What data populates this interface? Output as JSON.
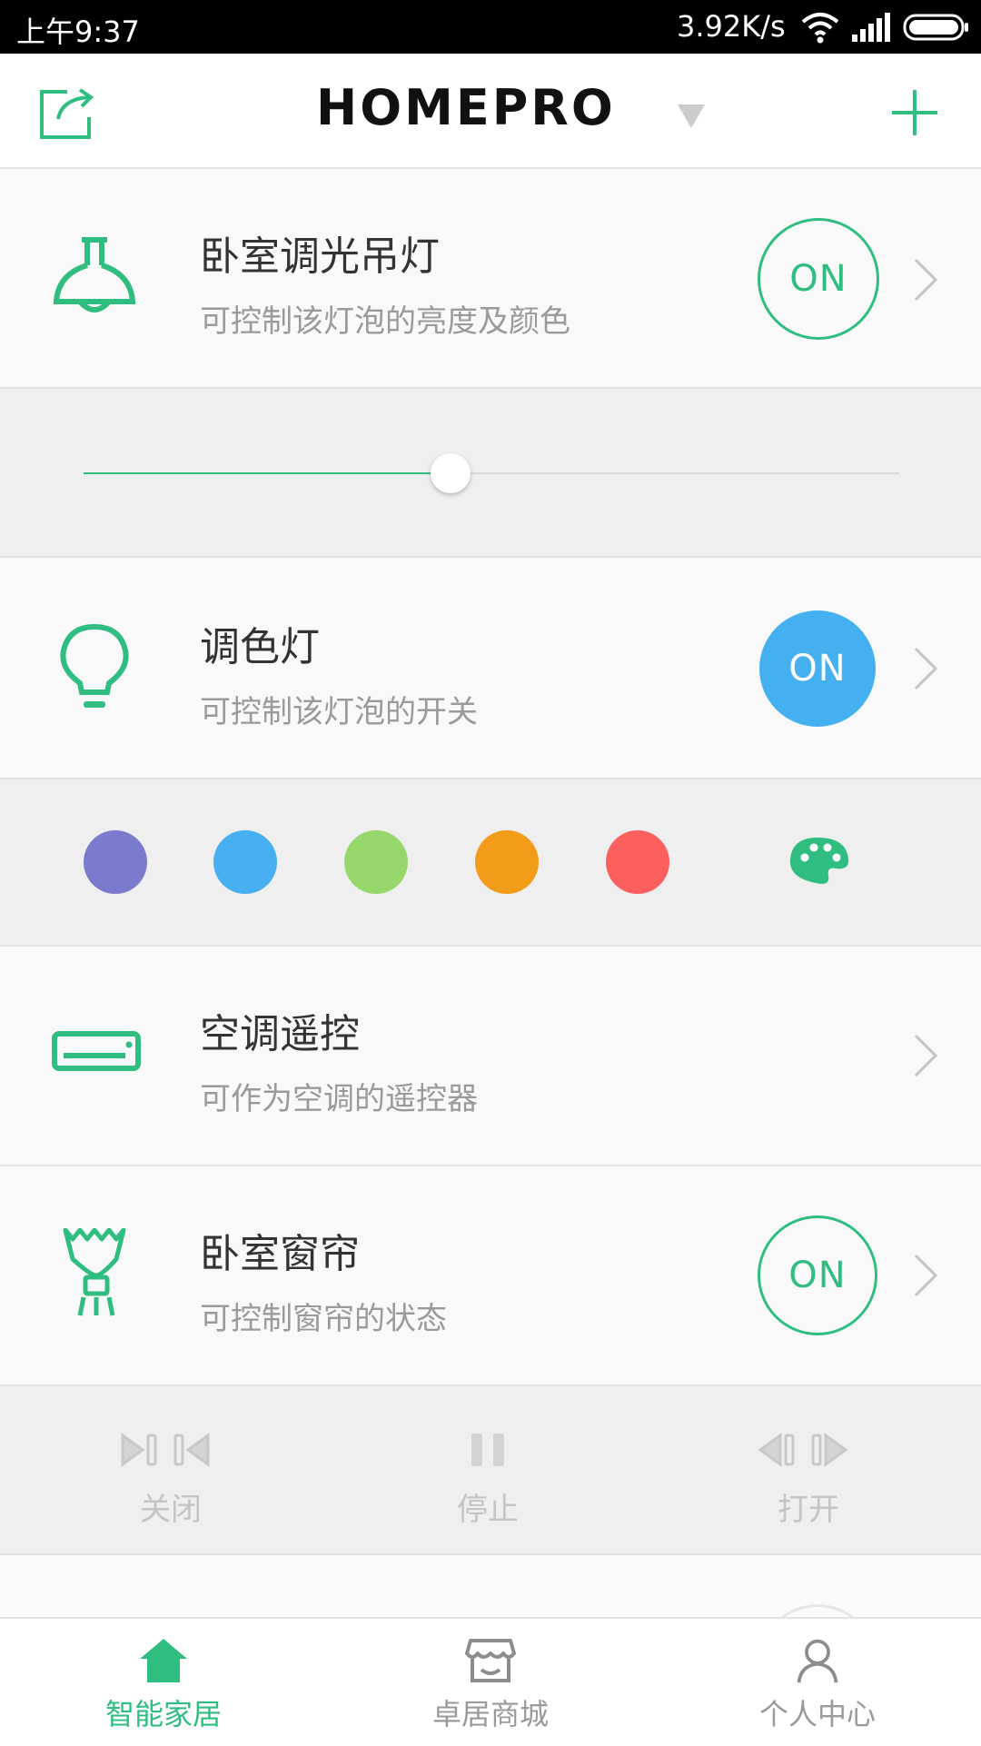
{
  "status_bar": {
    "time": "上午9:37",
    "net_speed": "3.92K/s",
    "icons": [
      "wifi-icon",
      "signal-icon",
      "battery-icon"
    ]
  },
  "header": {
    "logo_text": "HOMEPRO",
    "left_icon": "share-icon",
    "right_icon": "plus-icon"
  },
  "devices": [
    {
      "title": "卧室调光吊灯",
      "subtitle": "可控制该灯泡的亮度及颜色",
      "icon": "pendant-lamp-icon",
      "on_label": "ON",
      "toggle_style": "outline",
      "brightness": 0.45
    },
    {
      "title": "调色灯",
      "subtitle": "可控制该灯泡的开关",
      "icon": "light-bulb-icon",
      "on_label": "ON",
      "toggle_style": "filled",
      "color_swatches": [
        "#7b7bcd",
        "#48aff0",
        "#96d86c",
        "#f39c1a",
        "#fc605e"
      ]
    },
    {
      "title": "空调遥控",
      "subtitle": "可作为空调的遥控器",
      "icon": "air-conditioner-icon"
    },
    {
      "title": "卧室窗帘",
      "subtitle": "可控制窗帘的状态",
      "icon": "curtain-icon",
      "on_label": "ON",
      "toggle_style": "outline",
      "controls": [
        {
          "label": "关闭",
          "icon": "curtain-close-icon"
        },
        {
          "label": "停止",
          "icon": "pause-icon"
        },
        {
          "label": "打开",
          "icon": "curtain-open-icon"
        }
      ]
    }
  ],
  "tab_bar": {
    "tabs": [
      {
        "label": "智能家居",
        "icon": "home-icon",
        "active": true
      },
      {
        "label": "卓居商城",
        "icon": "store-icon",
        "active": false
      },
      {
        "label": "个人中心",
        "icon": "user-icon",
        "active": false
      }
    ]
  },
  "colors": {
    "accent": "#2fbd80",
    "on_filled": "#45b0f0",
    "inactive_text": "#9a9a9a"
  }
}
